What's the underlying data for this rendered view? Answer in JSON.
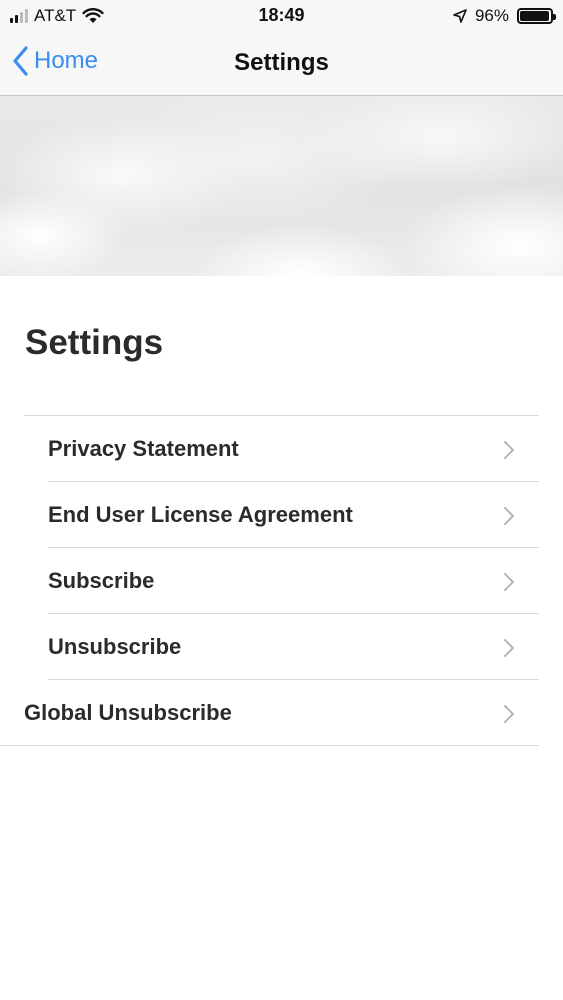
{
  "status_bar": {
    "carrier": "AT&T",
    "time": "18:49",
    "battery_percent": "96%",
    "battery_level": 0.96,
    "signal_bars_filled": 2,
    "icons": [
      "signal-icon",
      "wifi-icon",
      "location-arrow-icon",
      "battery-icon"
    ]
  },
  "nav": {
    "back_label": "Home",
    "title": "Settings",
    "accent_color": "#3a8ef0"
  },
  "page": {
    "heading": "Settings"
  },
  "settings_items": [
    {
      "label": "Privacy Statement"
    },
    {
      "label": "End User License Agreement"
    },
    {
      "label": "Subscribe"
    },
    {
      "label": "Unsubscribe"
    },
    {
      "label": "Global Unsubscribe"
    }
  ]
}
